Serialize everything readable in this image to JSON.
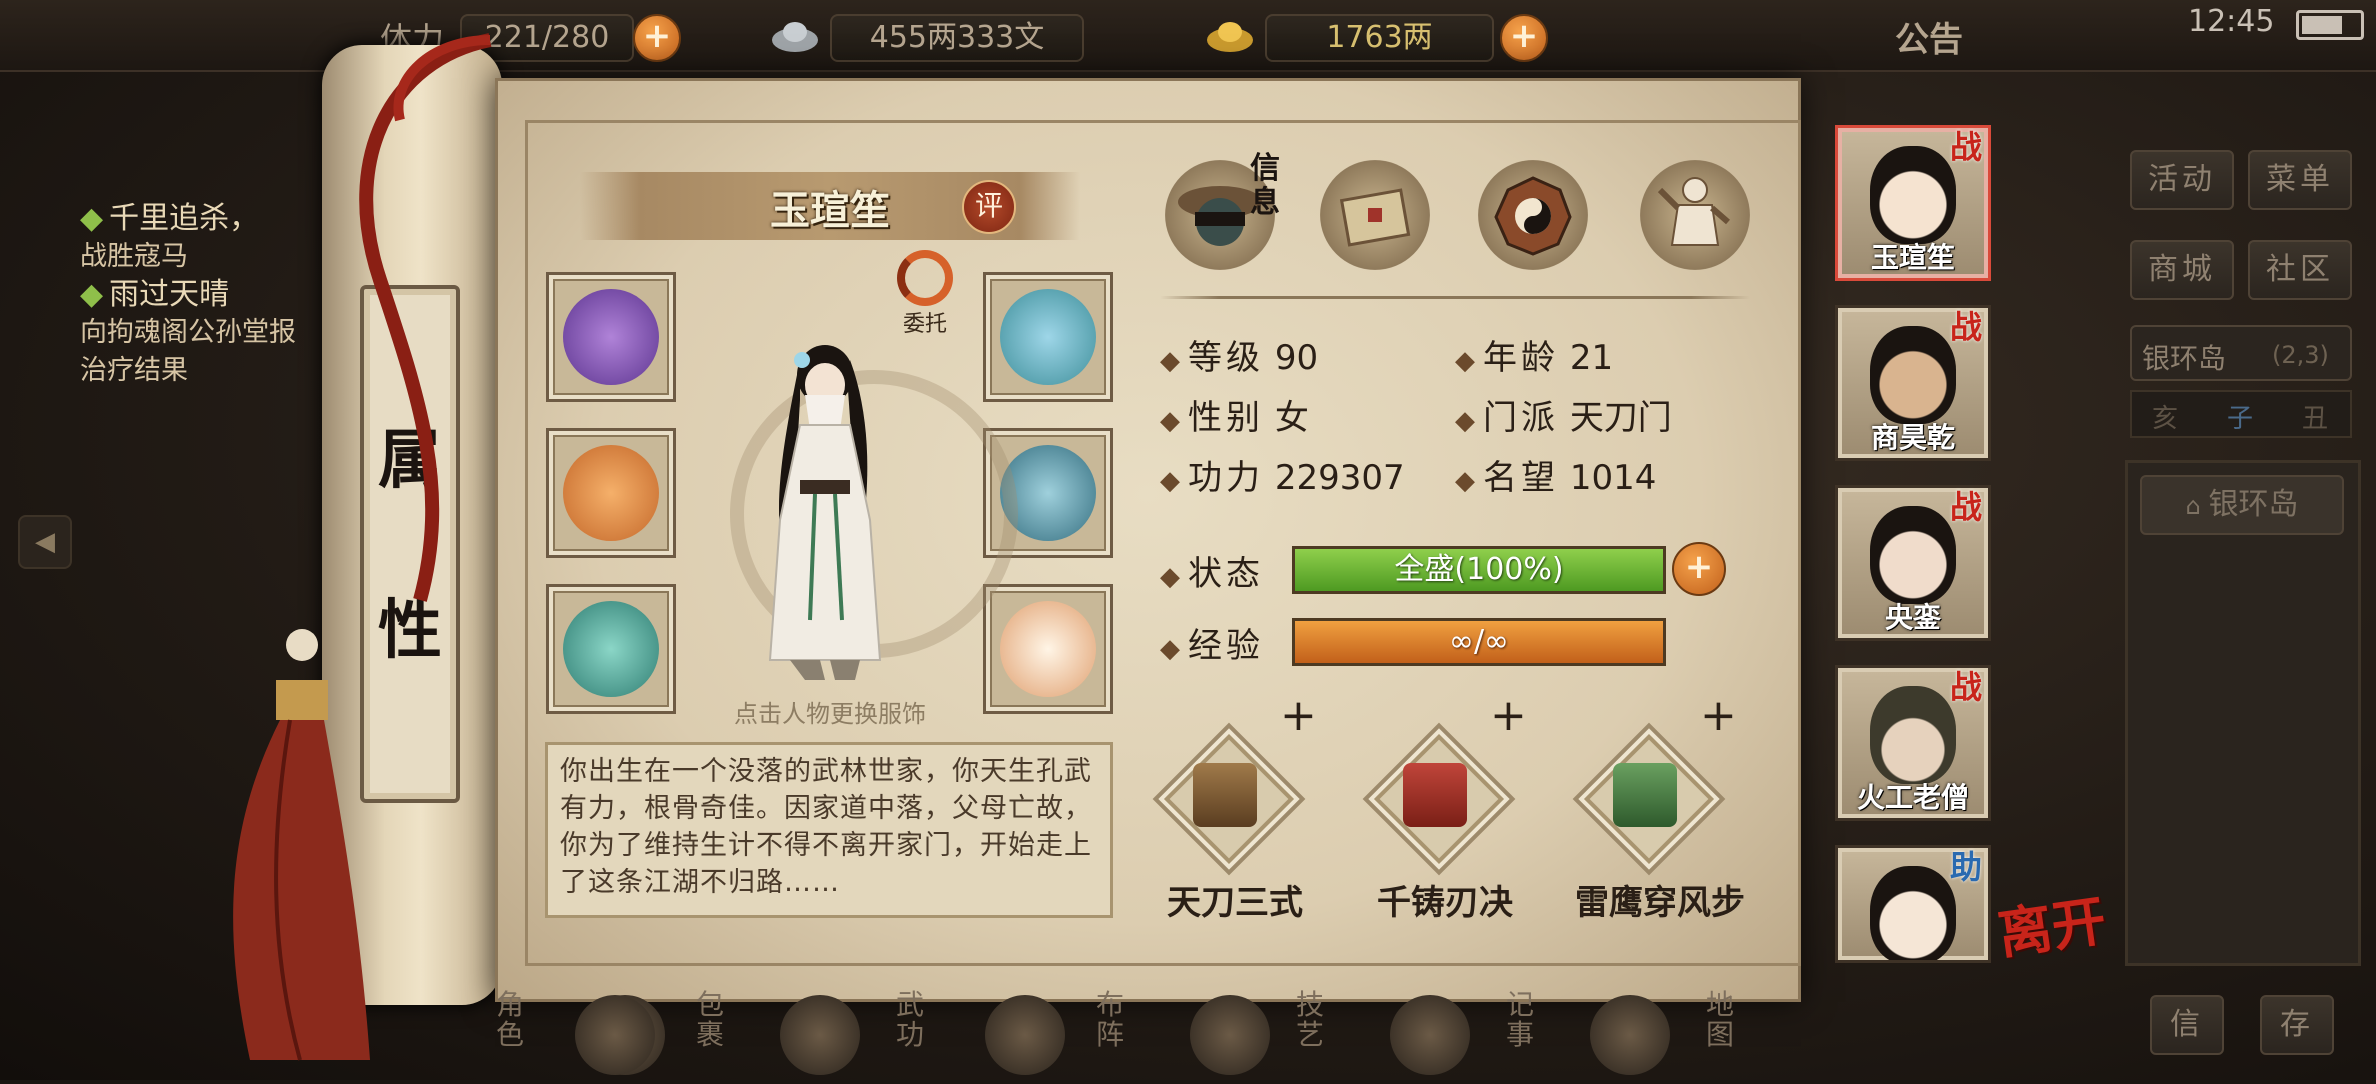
{
  "topbar": {
    "stamina_label": "体力",
    "stamina_value": "221/280",
    "silver": "455两333文",
    "gold": "1763两",
    "notice": "公告",
    "clock": "12:45"
  },
  "quests": [
    {
      "title": "千里追杀，",
      "desc": "战胜寇马"
    },
    {
      "title": "雨过天晴",
      "desc": "向拘魂阁公孙堂报治疗结果"
    }
  ],
  "scroll": {
    "title_chars": [
      "属",
      "性"
    ]
  },
  "character": {
    "name": "玉瑄笙",
    "review_label": "评",
    "entrust_label": "委托",
    "change_outfit_hint": "点击人物更换服饰",
    "bio": "你出生在一个没落的武林世家，你天生孔武有力，根骨奇佳。因家道中落，父母亡故，你为了维持生计不得不离开家门，开始走上了这条江湖不归路……"
  },
  "equipment": [
    {
      "slot": "gloves",
      "icon": "gloves-icon",
      "color": "#7b4fb0"
    },
    {
      "slot": "headband",
      "icon": "headband-icon",
      "color": "#3f9a8c"
    },
    {
      "slot": "weapon",
      "icon": "blade-icon",
      "color": "#d9863a"
    },
    {
      "slot": "armor",
      "icon": "armor-icon",
      "color": "#4a7d8f"
    },
    {
      "slot": "ring",
      "icon": "ring-icon",
      "color": "#3f8f84"
    },
    {
      "slot": "amulet",
      "icon": "amulet-icon",
      "color": "#e0d6c2"
    }
  ],
  "tabs": [
    {
      "label": "信息",
      "icon": "info-icon"
    },
    {
      "label": "",
      "icon": "letter-icon"
    },
    {
      "label": "",
      "icon": "bagua-icon"
    },
    {
      "label": "",
      "icon": "meridian-icon"
    }
  ],
  "stats": {
    "level_label": "等级",
    "level": "90",
    "age_label": "年龄",
    "age": "21",
    "gender_label": "性别",
    "gender": "女",
    "sect_label": "门派",
    "sect": "天刀门",
    "power_label": "功力",
    "power": "229307",
    "fame_label": "名望",
    "fame": "1014",
    "status_label": "状态",
    "status_value": "全盛(100%)",
    "status_fill": 1.0,
    "exp_label": "经验",
    "exp_value": "∞/∞",
    "exp_fill": 1.0
  },
  "skills": [
    {
      "name": "天刀三式",
      "plus": "+",
      "icon": "book-icon"
    },
    {
      "name": "千铸刃决",
      "plus": "+",
      "icon": "scroll-icon"
    },
    {
      "name": "雷鹰穿风步",
      "plus": "+",
      "icon": "jade-scroll-icon"
    }
  ],
  "party": [
    {
      "name": "玉瑄笙",
      "badge": "战",
      "selected": true
    },
    {
      "name": "商昊乾",
      "badge": "战",
      "selected": false
    },
    {
      "name": "央銮",
      "badge": "战",
      "selected": false
    },
    {
      "name": "火工老僧",
      "badge": "战",
      "selected": false
    },
    {
      "name": "",
      "badge": "助",
      "selected": false
    }
  ],
  "leave_label": "离开",
  "right_menu": {
    "activity": "活动",
    "menu": "菜单",
    "shop": "商城",
    "community": "社区",
    "location": "银环岛",
    "coords": "(2,3)",
    "time_chars": [
      "亥",
      "子",
      "丑"
    ],
    "location_button": "银环岛",
    "btn_a": "信",
    "btn_b": "存"
  },
  "bottom_nav": [
    "角色",
    "包裹",
    "武功",
    "布阵",
    "技艺",
    "记事",
    "地图"
  ]
}
